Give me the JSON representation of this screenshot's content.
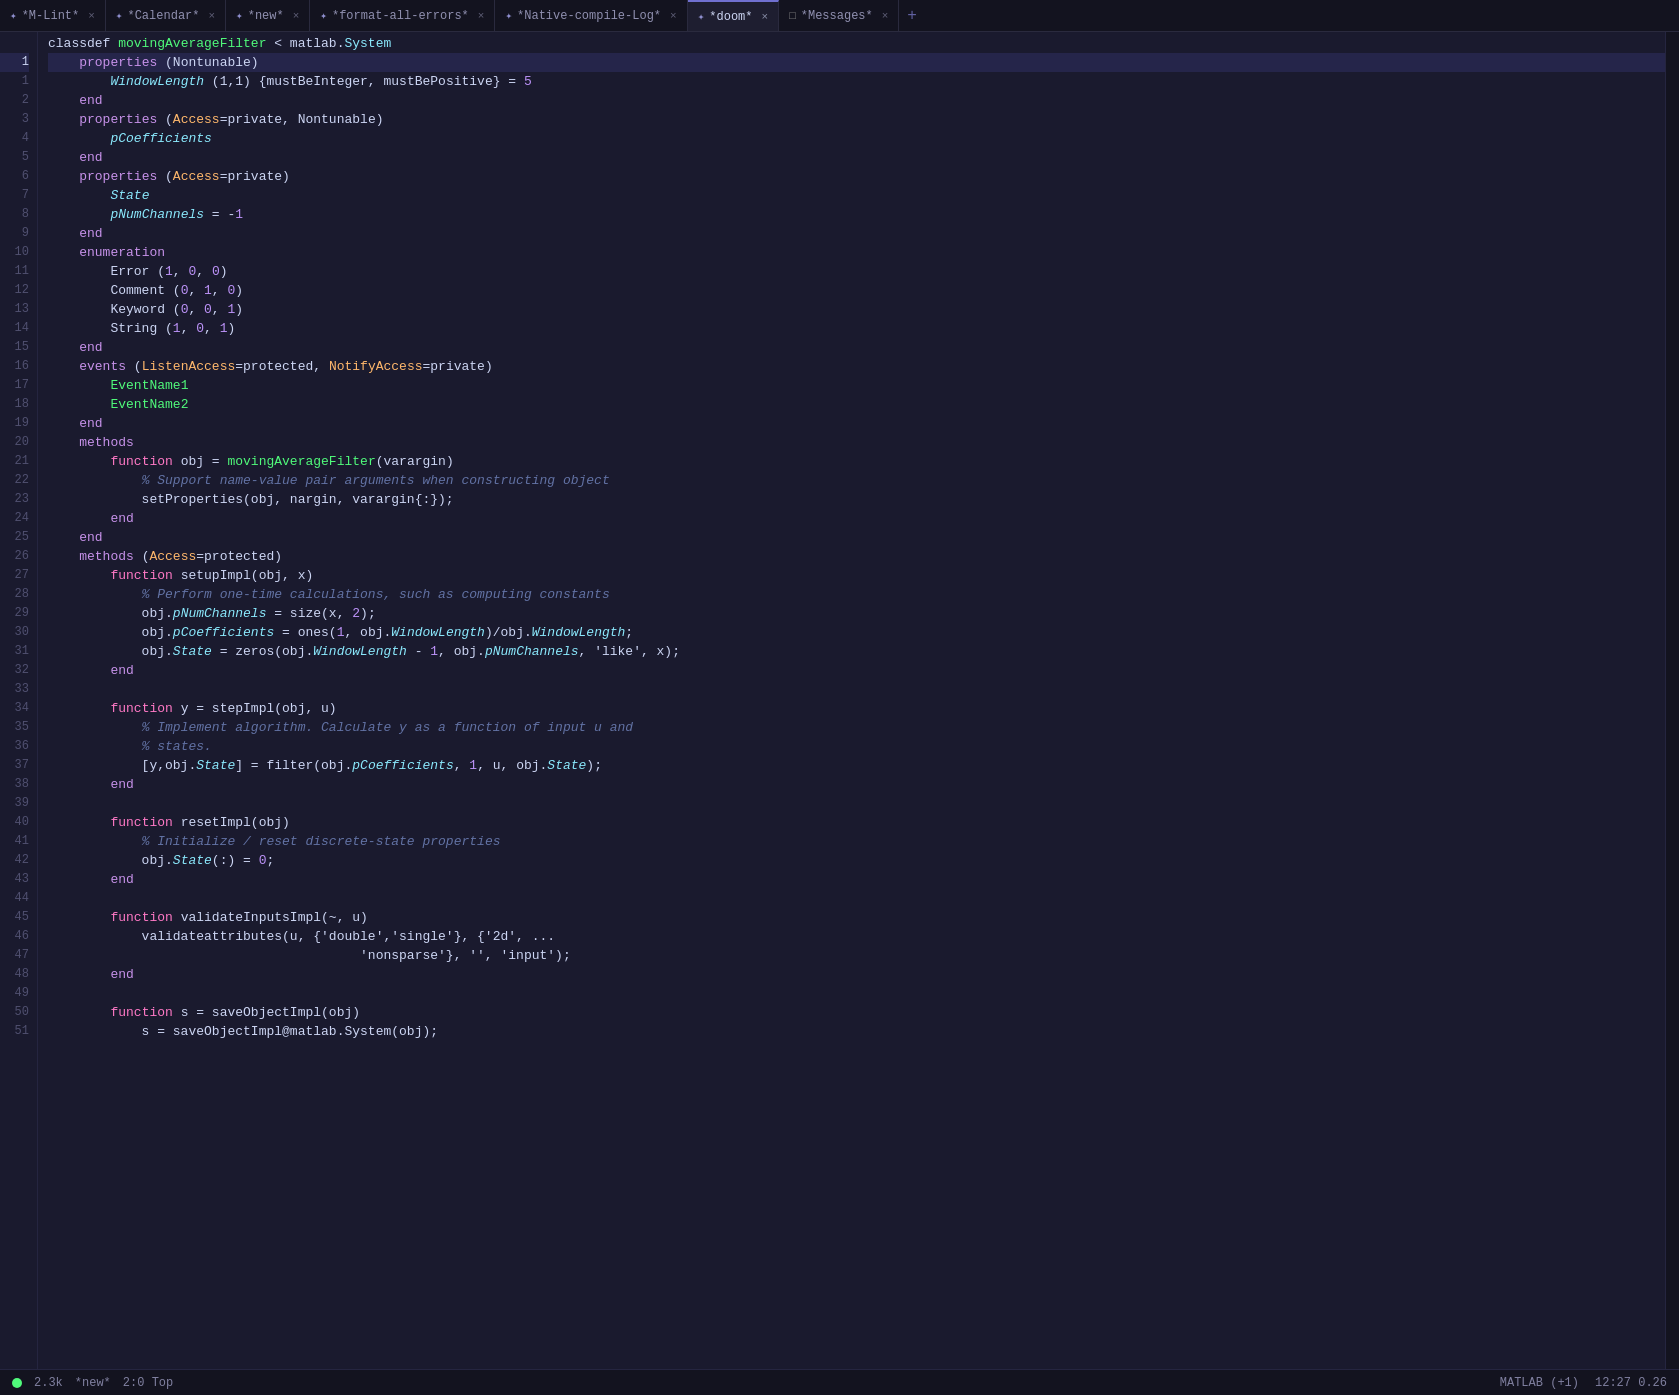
{
  "tabs": [
    {
      "id": "mlint",
      "icon_color": "#7070d0",
      "icon_sym": "✦",
      "label": "*M-Lint*",
      "active": false,
      "modified": true
    },
    {
      "id": "calendar",
      "icon_color": "#7070d0",
      "icon_sym": "✦",
      "label": "*Calendar*",
      "active": false,
      "modified": true
    },
    {
      "id": "new",
      "icon_color": "#7070d0",
      "icon_sym": "✦",
      "label": "*new*",
      "active": false,
      "modified": true
    },
    {
      "id": "format-all-errors",
      "icon_color": "#7070d0",
      "icon_sym": "✦",
      "label": "*format-all-errors*",
      "active": false,
      "modified": true
    },
    {
      "id": "native-compile-log",
      "icon_color": "#7070d0",
      "icon_sym": "✦",
      "label": "*Native-compile-Log*",
      "active": false,
      "modified": true
    },
    {
      "id": "doom",
      "icon_color": "#7070d0",
      "icon_sym": "✦",
      "label": "*doom*",
      "active": true,
      "modified": true
    },
    {
      "id": "messages",
      "icon_color": "#888",
      "icon_sym": "□",
      "label": "*Messages*",
      "active": false,
      "modified": true
    }
  ],
  "lines": [
    {
      "num": "",
      "content": [
        {
          "t": "plain",
          "v": "classdef "
        },
        {
          "t": "id",
          "v": "movingAverageFilter"
        },
        {
          "t": "plain",
          "v": " < matlab."
        },
        {
          "t": "cls",
          "v": "System"
        }
      ]
    },
    {
      "num": "1",
      "content": [
        {
          "t": "plain",
          "v": "    "
        },
        {
          "t": "kw",
          "v": "properties"
        },
        {
          "t": "plain",
          "v": " (Nontunable)"
        }
      ],
      "active": true
    },
    {
      "num": "1",
      "content": [
        {
          "t": "plain",
          "v": "        "
        },
        {
          "t": "id2",
          "v": "WindowLength"
        },
        {
          "t": "plain",
          "v": " (1,1) {mustBeInteger, mustBePositive} = "
        },
        {
          "t": "num",
          "v": "5"
        }
      ]
    },
    {
      "num": "2",
      "content": [
        {
          "t": "plain",
          "v": "    "
        },
        {
          "t": "kw",
          "v": "end"
        }
      ]
    },
    {
      "num": "3",
      "content": [
        {
          "t": "plain",
          "v": "    "
        },
        {
          "t": "kw",
          "v": "properties"
        },
        {
          "t": "plain",
          "v": " ("
        },
        {
          "t": "attr",
          "v": "Access"
        },
        {
          "t": "plain",
          "v": "=private, Nontunable)"
        }
      ]
    },
    {
      "num": "4",
      "content": [
        {
          "t": "plain",
          "v": "        "
        },
        {
          "t": "id2",
          "v": "pCoefficients"
        }
      ]
    },
    {
      "num": "5",
      "content": [
        {
          "t": "plain",
          "v": "    "
        },
        {
          "t": "kw",
          "v": "end"
        }
      ]
    },
    {
      "num": "6",
      "content": [
        {
          "t": "plain",
          "v": "    "
        },
        {
          "t": "kw",
          "v": "properties"
        },
        {
          "t": "plain",
          "v": " ("
        },
        {
          "t": "attr",
          "v": "Access"
        },
        {
          "t": "plain",
          "v": "=private)"
        }
      ]
    },
    {
      "num": "7",
      "content": [
        {
          "t": "plain",
          "v": "        "
        },
        {
          "t": "id2",
          "v": "State"
        }
      ]
    },
    {
      "num": "8",
      "content": [
        {
          "t": "plain",
          "v": "        "
        },
        {
          "t": "id2",
          "v": "pNumChannels"
        },
        {
          "t": "plain",
          "v": " = -"
        },
        {
          "t": "num",
          "v": "1"
        }
      ]
    },
    {
      "num": "9",
      "content": [
        {
          "t": "plain",
          "v": "    "
        },
        {
          "t": "kw",
          "v": "end"
        }
      ]
    },
    {
      "num": "10",
      "content": [
        {
          "t": "plain",
          "v": "    "
        },
        {
          "t": "kw",
          "v": "enumeration"
        }
      ]
    },
    {
      "num": "11",
      "content": [
        {
          "t": "plain",
          "v": "        Error ("
        },
        {
          "t": "num",
          "v": "1"
        },
        {
          "t": "plain",
          "v": ", "
        },
        {
          "t": "num",
          "v": "0"
        },
        {
          "t": "plain",
          "v": ", "
        },
        {
          "t": "num",
          "v": "0"
        },
        {
          "t": "plain",
          "v": ")"
        }
      ]
    },
    {
      "num": "12",
      "content": [
        {
          "t": "plain",
          "v": "        Comment ("
        },
        {
          "t": "num",
          "v": "0"
        },
        {
          "t": "plain",
          "v": ", "
        },
        {
          "t": "num",
          "v": "1"
        },
        {
          "t": "plain",
          "v": ", "
        },
        {
          "t": "num",
          "v": "0"
        },
        {
          "t": "plain",
          "v": ")"
        }
      ]
    },
    {
      "num": "13",
      "content": [
        {
          "t": "plain",
          "v": "        Keyword ("
        },
        {
          "t": "num",
          "v": "0"
        },
        {
          "t": "plain",
          "v": ", "
        },
        {
          "t": "num",
          "v": "0"
        },
        {
          "t": "plain",
          "v": ", "
        },
        {
          "t": "num",
          "v": "1"
        },
        {
          "t": "plain",
          "v": ")"
        }
      ]
    },
    {
      "num": "14",
      "content": [
        {
          "t": "plain",
          "v": "        String ("
        },
        {
          "t": "num",
          "v": "1"
        },
        {
          "t": "plain",
          "v": ", "
        },
        {
          "t": "num",
          "v": "0"
        },
        {
          "t": "plain",
          "v": ", "
        },
        {
          "t": "num",
          "v": "1"
        },
        {
          "t": "plain",
          "v": ")"
        }
      ]
    },
    {
      "num": "15",
      "content": [
        {
          "t": "plain",
          "v": "    "
        },
        {
          "t": "kw",
          "v": "end"
        }
      ]
    },
    {
      "num": "16",
      "content": [
        {
          "t": "plain",
          "v": "    "
        },
        {
          "t": "kw",
          "v": "events"
        },
        {
          "t": "plain",
          "v": " ("
        },
        {
          "t": "attr",
          "v": "ListenAccess"
        },
        {
          "t": "plain",
          "v": "=protected, "
        },
        {
          "t": "attr",
          "v": "NotifyAccess"
        },
        {
          "t": "plain",
          "v": "=private)"
        }
      ]
    },
    {
      "num": "17",
      "content": [
        {
          "t": "plain",
          "v": "        "
        },
        {
          "t": "ev",
          "v": "EventName1"
        }
      ]
    },
    {
      "num": "18",
      "content": [
        {
          "t": "plain",
          "v": "        "
        },
        {
          "t": "ev",
          "v": "EventName2"
        }
      ]
    },
    {
      "num": "19",
      "content": [
        {
          "t": "plain",
          "v": "    "
        },
        {
          "t": "kw",
          "v": "end"
        }
      ]
    },
    {
      "num": "20",
      "content": [
        {
          "t": "plain",
          "v": "    "
        },
        {
          "t": "kw",
          "v": "methods"
        }
      ]
    },
    {
      "num": "21",
      "content": [
        {
          "t": "plain",
          "v": "        "
        },
        {
          "t": "kw2",
          "v": "function"
        },
        {
          "t": "plain",
          "v": " obj = "
        },
        {
          "t": "fn",
          "v": "movingAverageFilter"
        },
        {
          "t": "plain",
          "v": "(varargin)"
        }
      ]
    },
    {
      "num": "22",
      "content": [
        {
          "t": "plain",
          "v": "            "
        },
        {
          "t": "cm",
          "v": "% Support name-value pair arguments when constructing object"
        }
      ]
    },
    {
      "num": "23",
      "content": [
        {
          "t": "plain",
          "v": "            setProperties(obj, nargin, varargin{:});"
        }
      ]
    },
    {
      "num": "24",
      "content": [
        {
          "t": "plain",
          "v": "        "
        },
        {
          "t": "kw",
          "v": "end"
        }
      ]
    },
    {
      "num": "25",
      "content": [
        {
          "t": "plain",
          "v": "    "
        },
        {
          "t": "kw",
          "v": "end"
        }
      ]
    },
    {
      "num": "26",
      "content": [
        {
          "t": "plain",
          "v": "    "
        },
        {
          "t": "kw",
          "v": "methods"
        },
        {
          "t": "plain",
          "v": " ("
        },
        {
          "t": "attr",
          "v": "Access"
        },
        {
          "t": "plain",
          "v": "=protected)"
        }
      ]
    },
    {
      "num": "27",
      "content": [
        {
          "t": "plain",
          "v": "        "
        },
        {
          "t": "kw2",
          "v": "function"
        },
        {
          "t": "plain",
          "v": " setupImpl(obj, x)"
        }
      ]
    },
    {
      "num": "28",
      "content": [
        {
          "t": "plain",
          "v": "            "
        },
        {
          "t": "cm",
          "v": "% Perform one-time calculations, such as computing constants"
        }
      ]
    },
    {
      "num": "29",
      "content": [
        {
          "t": "plain",
          "v": "            obj."
        },
        {
          "t": "id2",
          "v": "pNumChannels"
        },
        {
          "t": "plain",
          "v": " = size(x, "
        },
        {
          "t": "num",
          "v": "2"
        },
        {
          "t": "plain",
          "v": ");"
        }
      ]
    },
    {
      "num": "30",
      "content": [
        {
          "t": "plain",
          "v": "            obj."
        },
        {
          "t": "id2",
          "v": "pCoefficients"
        },
        {
          "t": "plain",
          "v": " = ones("
        },
        {
          "t": "num",
          "v": "1"
        },
        {
          "t": "plain",
          "v": ", obj."
        },
        {
          "t": "id2",
          "v": "WindowLength"
        },
        {
          "t": "plain",
          "v": ")/obj."
        },
        {
          "t": "id2",
          "v": "WindowLength"
        },
        {
          "t": "plain",
          "v": ";"
        }
      ]
    },
    {
      "num": "31",
      "content": [
        {
          "t": "plain",
          "v": "            obj."
        },
        {
          "t": "id2",
          "v": "State"
        },
        {
          "t": "plain",
          "v": " = zeros(obj."
        },
        {
          "t": "id2",
          "v": "WindowLength"
        },
        {
          "t": "plain",
          "v": " - "
        },
        {
          "t": "num",
          "v": "1"
        },
        {
          "t": "plain",
          "v": ", obj."
        },
        {
          "t": "id2",
          "v": "pNumChannels"
        },
        {
          "t": "plain",
          "v": ", 'like', x);"
        }
      ]
    },
    {
      "num": "32",
      "content": [
        {
          "t": "plain",
          "v": "        "
        },
        {
          "t": "kw",
          "v": "end"
        }
      ]
    },
    {
      "num": "33",
      "content": []
    },
    {
      "num": "34",
      "content": [
        {
          "t": "plain",
          "v": "        "
        },
        {
          "t": "kw2",
          "v": "function"
        },
        {
          "t": "plain",
          "v": " y = stepImpl(obj, u)"
        }
      ]
    },
    {
      "num": "35",
      "content": [
        {
          "t": "plain",
          "v": "            "
        },
        {
          "t": "cm",
          "v": "% Implement algorithm. Calculate y as a function of input u and"
        }
      ]
    },
    {
      "num": "36",
      "content": [
        {
          "t": "plain",
          "v": "            "
        },
        {
          "t": "cm",
          "v": "% states."
        }
      ]
    },
    {
      "num": "37",
      "content": [
        {
          "t": "plain",
          "v": "            [y,obj."
        },
        {
          "t": "id2",
          "v": "State"
        },
        {
          "t": "plain",
          "v": "] = filter(obj."
        },
        {
          "t": "id2",
          "v": "pCoefficients"
        },
        {
          "t": "plain",
          "v": ", "
        },
        {
          "t": "num",
          "v": "1"
        },
        {
          "t": "plain",
          "v": ", u, obj."
        },
        {
          "t": "id2",
          "v": "State"
        },
        {
          "t": "plain",
          "v": ");"
        }
      ]
    },
    {
      "num": "38",
      "content": [
        {
          "t": "plain",
          "v": "        "
        },
        {
          "t": "kw",
          "v": "end"
        }
      ]
    },
    {
      "num": "39",
      "content": []
    },
    {
      "num": "40",
      "content": [
        {
          "t": "plain",
          "v": "        "
        },
        {
          "t": "kw2",
          "v": "function"
        },
        {
          "t": "plain",
          "v": " resetImpl(obj)"
        }
      ]
    },
    {
      "num": "41",
      "content": [
        {
          "t": "plain",
          "v": "            "
        },
        {
          "t": "cm",
          "v": "% Initialize / reset discrete-state properties"
        }
      ]
    },
    {
      "num": "42",
      "content": [
        {
          "t": "plain",
          "v": "            obj."
        },
        {
          "t": "id2",
          "v": "State"
        },
        {
          "t": "plain",
          "v": "(:) = "
        },
        {
          "t": "num",
          "v": "0"
        },
        {
          "t": "plain",
          "v": ";"
        }
      ]
    },
    {
      "num": "43",
      "content": [
        {
          "t": "plain",
          "v": "        "
        },
        {
          "t": "kw",
          "v": "end"
        }
      ]
    },
    {
      "num": "44",
      "content": []
    },
    {
      "num": "45",
      "content": [
        {
          "t": "plain",
          "v": "        "
        },
        {
          "t": "kw2",
          "v": "function"
        },
        {
          "t": "plain",
          "v": " validateInputsImpl(~, u)"
        }
      ]
    },
    {
      "num": "46",
      "content": [
        {
          "t": "plain",
          "v": "            validateattributes(u, {'double','single'}, {'2d', ..."
        }
      ]
    },
    {
      "num": "47",
      "content": [
        {
          "t": "plain",
          "v": "                                        'nonsparse'}, '', 'input');"
        }
      ]
    },
    {
      "num": "48",
      "content": [
        {
          "t": "plain",
          "v": "        "
        },
        {
          "t": "kw",
          "v": "end"
        }
      ]
    },
    {
      "num": "49",
      "content": []
    },
    {
      "num": "50",
      "content": [
        {
          "t": "plain",
          "v": "        "
        },
        {
          "t": "kw2",
          "v": "function"
        },
        {
          "t": "plain",
          "v": " s = saveObjectImpl(obj)"
        }
      ]
    },
    {
      "num": "51",
      "content": [
        {
          "t": "plain",
          "v": "            s = saveObjectImpl@matlab.System(obj);"
        }
      ]
    }
  ],
  "first_line_num": "classdef",
  "status": {
    "dot_color": "#50fa7b",
    "left_items": [
      "2.3k",
      "*new*",
      "2:0 Top"
    ],
    "right_items": [
      "MATLAB (+1)",
      "12:27 0.26"
    ]
  },
  "colors": {
    "bg": "#1a1a2e",
    "tab_bg": "#13131f",
    "active_tab_bg": "#1e1e30",
    "line_active_bg": "#25254a",
    "accent": "#7070d0"
  }
}
